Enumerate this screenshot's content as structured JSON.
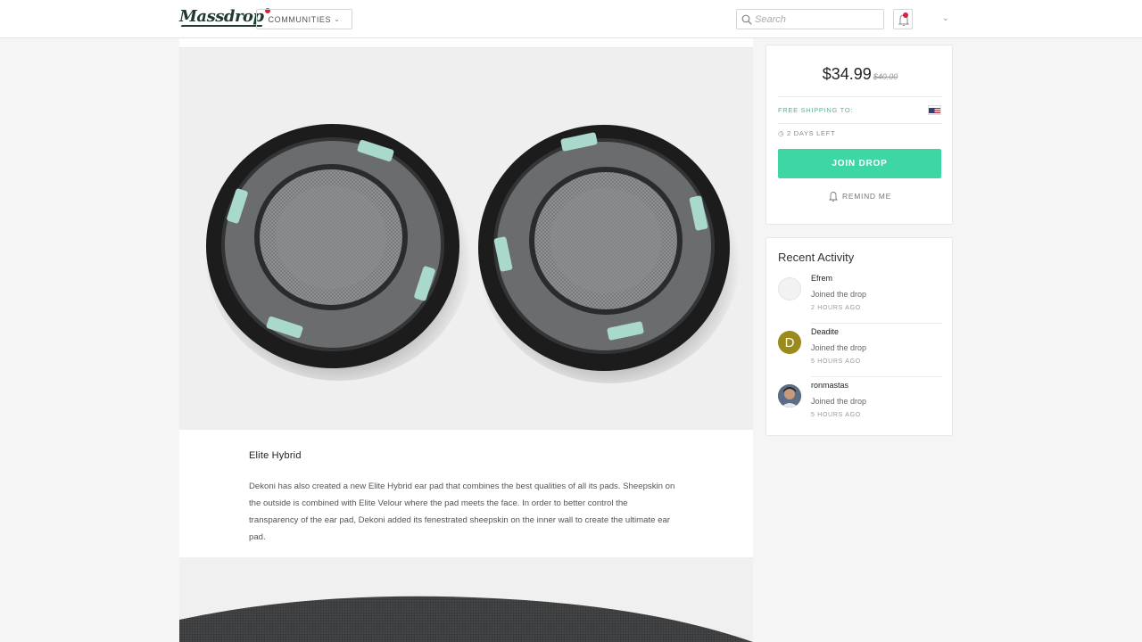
{
  "header": {
    "logo": "Massdrop",
    "communities_label": "COMMUNITIES",
    "search_placeholder": "Search"
  },
  "product": {
    "section_title": "Elite Hybrid",
    "section_body": "Dekoni has also created a new Elite Hybrid ear pad that combines the best qualities of all its pads. Sheepskin on the outside is combined with Elite Velour where the pad meets the face. In order to better control the transparency of the ear pad, Dekoni added its fenestrated sheepskin on the inner wall to create the ultimate ear pad."
  },
  "purchase": {
    "price": "$34.99",
    "old_price": "$40.00",
    "shipping_label": "FREE SHIPPING TO:",
    "days_left": "2 DAYS LEFT",
    "join_label": "JOIN DROP",
    "remind_label": "REMIND ME",
    "accent_color": "#3fd6a5"
  },
  "activity": {
    "title": "Recent Activity",
    "items": [
      {
        "name": "Efrem",
        "action": "Joined the drop",
        "time": "2 HOURS AGO",
        "avatar_letter": ""
      },
      {
        "name": "Deadite",
        "action": "Joined the drop",
        "time": "5 HOURS AGO",
        "avatar_letter": "D"
      },
      {
        "name": "ronmastas",
        "action": "Joined the drop",
        "time": "5 HOURS AGO",
        "avatar_letter": ""
      }
    ]
  }
}
